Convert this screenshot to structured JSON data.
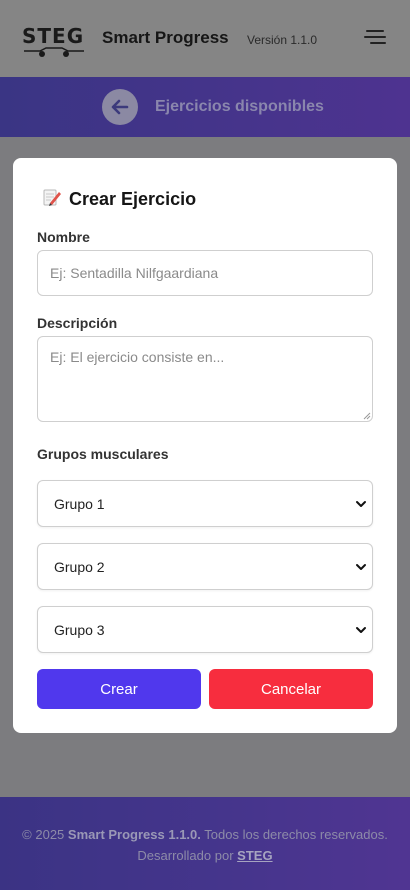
{
  "header": {
    "logo_text": "STEG",
    "app_title": "Smart Progress",
    "version": "Versión 1.1.0"
  },
  "banner": {
    "title": "Ejercicios disponibles"
  },
  "form": {
    "title": "Crear Ejercicio",
    "name_label": "Nombre",
    "name_placeholder": "Ej: Sentadilla Nilfgaardiana",
    "description_label": "Descripción",
    "description_placeholder": "Ej: El ejercicio consiste en...",
    "groups_label": "Grupos musculares",
    "groups": [
      {
        "selected": "Grupo 1"
      },
      {
        "selected": "Grupo 2"
      },
      {
        "selected": "Grupo 3"
      }
    ],
    "create_label": "Crear",
    "cancel_label": "Cancelar"
  },
  "footer": {
    "copyright_prefix": "© 2025",
    "app_name": "Smart Progress 1.1.0.",
    "rights": "Todos los derechos reservados.",
    "developed_by": "Desarrollado por",
    "developer": "STEG"
  },
  "colors": {
    "primary": "#5038ed",
    "danger": "#f72d3e",
    "banner": "#44348a"
  },
  "icons": [
    "menu-icon",
    "arrow-left-icon",
    "pencil-icon",
    "chevron-down-icon",
    "car-logo-icon"
  ]
}
